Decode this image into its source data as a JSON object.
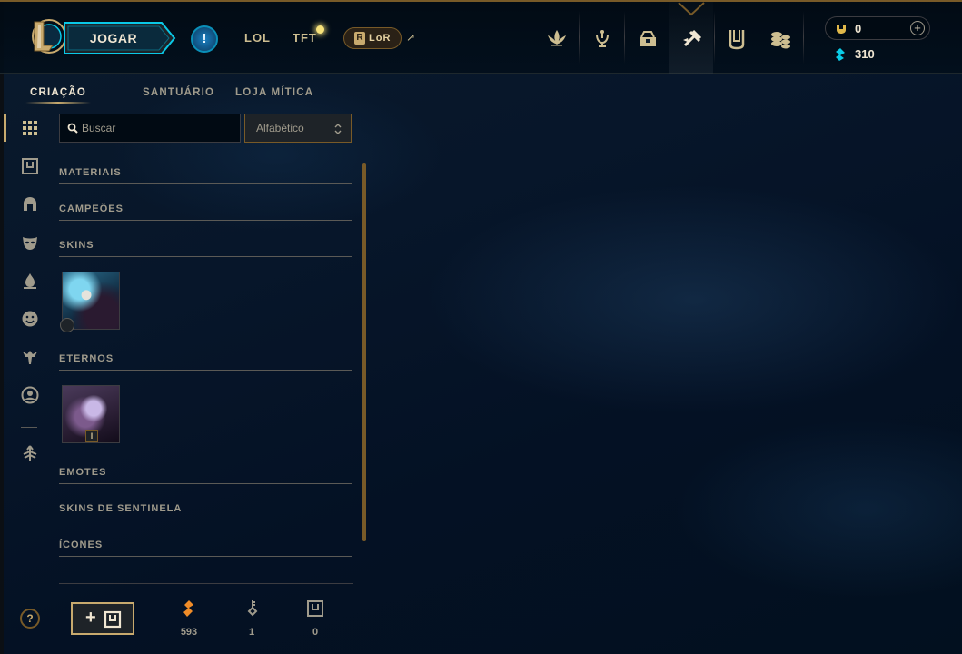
{
  "nav": {
    "play_label": "JOGAR",
    "alert_symbol": "!",
    "lol_label": "LOL",
    "tft_label": "TFT",
    "lor_label": "LoR",
    "lor_badge": "R",
    "external_link_arrow": "↗",
    "icons": [
      "profile-lotus-icon",
      "collection-icon",
      "loot-icon",
      "crafting-hammer-icon",
      "store-icon",
      "currency-stack-icon"
    ],
    "active_icon": "crafting-hammer-icon"
  },
  "wallet": {
    "rp_value": "0",
    "be_value": "310",
    "add_symbol": "+"
  },
  "subtabs": [
    "CRIAÇÃO",
    "SANTUÁRIO",
    "LOJA MÍTICA"
  ],
  "active_subtab": "CRIAÇÃO",
  "rail_icons": [
    "grid-icon",
    "chest-icon",
    "champion-helmet-icon",
    "skin-mask-icon",
    "ward-flame-icon",
    "emote-face-icon",
    "sentinel-icon",
    "summoner-icon",
    "eternal-arrows-icon"
  ],
  "search": {
    "placeholder": "Buscar"
  },
  "sort": {
    "selected": "Alfabético",
    "arrows": "⌃⌄"
  },
  "categories": {
    "materials": "MATERIAIS",
    "champions": "CAMPEÕES",
    "skins": "SKINS",
    "eternals": "ETERNOS",
    "emotes": "EMOTES",
    "ward_skins": "SKINS DE SENTINELA",
    "icons": "ÍCONES"
  },
  "eternal_tile_number": "I",
  "bottom": {
    "help_symbol": "?",
    "add_chest_symbol": "+",
    "resources": [
      {
        "name": "orange-essence-icon",
        "value": "593"
      },
      {
        "name": "key-icon",
        "value": "1"
      },
      {
        "name": "chest-icon",
        "value": "0"
      }
    ]
  },
  "colors": {
    "gold": "#c8aa6e",
    "gold_dark": "#785a28",
    "text": "#a09b8c",
    "bright_text": "#f0e6d2",
    "blue_essence": "#0acbe6",
    "orange_essence": "#f08c28"
  }
}
